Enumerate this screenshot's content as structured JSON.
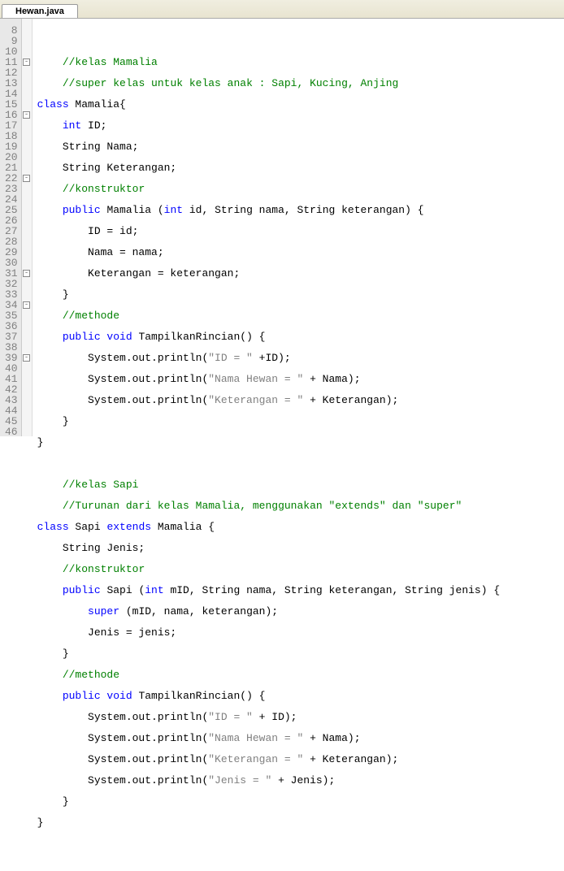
{
  "tab": {
    "label": "Hewan.java"
  },
  "lines": {
    "start": 8,
    "end": 46
  },
  "code": {
    "l8": "",
    "l9_cmt": "//kelas Mamalia",
    "l10_cmt": "//super kelas untuk kelas anak : Sapi, Kucing, Anjing",
    "l11_kw": "class",
    "l11_name": " Mamalia{",
    "l12_kw": "int",
    "l12_rest": " ID;",
    "l13": "    String Nama;",
    "l14": "    String Keterangan;",
    "l15_cmt": "//konstruktor",
    "l16_kw1": "public",
    "l16_mid": " Mamalia (",
    "l16_kw2": "int",
    "l16_rest": " id, String nama, String keterangan) {",
    "l17": "        ID = id;",
    "l18": "        Nama = nama;",
    "l19": "        Keterangan = keterangan;",
    "l20": "    }",
    "l21_cmt": "//methode",
    "l22_kw": "public void",
    "l22_rest": " TampilkanRincian() {",
    "l23_a": "        System.out.println(",
    "l23_s": "\"ID = \"",
    "l23_b": " +ID);",
    "l24_a": "        System.out.println(",
    "l24_s": "\"Nama Hewan = \"",
    "l24_b": " + Nama);",
    "l25_a": "        System.out.println(",
    "l25_s": "\"Keterangan = \"",
    "l25_b": " + Keterangan);",
    "l26": "    }",
    "l27": "}",
    "l28": "",
    "l29_cmt": "//kelas Sapi",
    "l30_cmt": "//Turunan dari kelas Mamalia, menggunakan \"extends\" dan \"super\"",
    "l31_kw1": "class",
    "l31_mid": " Sapi ",
    "l31_kw2": "extends",
    "l31_rest": " Mamalia {",
    "l32": "    String Jenis;",
    "l33_cmt": "//konstruktor",
    "l34_kw1": "public",
    "l34_mid": " Sapi (",
    "l34_kw2": "int",
    "l34_rest": " mID, String nama, String keterangan, String jenis) {",
    "l35_kw": "super",
    "l35_rest": " (mID, nama, keterangan);",
    "l36": "        Jenis = jenis;",
    "l37": "    }",
    "l38_cmt": "//methode",
    "l39_kw": "public void",
    "l39_rest": " TampilkanRincian() {",
    "l40_a": "        System.out.println(",
    "l40_s": "\"ID = \"",
    "l40_b": " + ID);",
    "l41_a": "        System.out.println(",
    "l41_s": "\"Nama Hewan = \"",
    "l41_b": " + Nama);",
    "l42_a": "        System.out.println(",
    "l42_s": "\"Keterangan = \"",
    "l42_b": " + Keterangan);",
    "l43_a": "        System.out.println(",
    "l43_s": "\"Jenis = \"",
    "l43_b": " + Jenis);",
    "l44": "    }",
    "l45": "}",
    "l46": ""
  },
  "fold_marks": [
    11,
    16,
    22,
    31,
    34,
    39
  ]
}
